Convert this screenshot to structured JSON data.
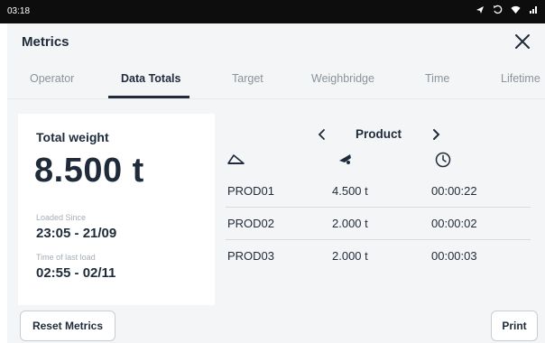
{
  "status_bar": {
    "time": "03:18",
    "icons": [
      "location-icon",
      "sync-icon",
      "wifi-icon",
      "signal-icon"
    ]
  },
  "header": {
    "title": "Metrics",
    "close_icon": "close-icon"
  },
  "tabs": [
    {
      "label": "Operator",
      "active": false
    },
    {
      "label": "Data Totals",
      "active": true
    },
    {
      "label": "Target",
      "active": false
    },
    {
      "label": "Weighbridge",
      "active": false
    },
    {
      "label": "Time",
      "active": false
    },
    {
      "label": "Lifetime",
      "active": false
    }
  ],
  "summary": {
    "title": "Total weight",
    "total": "8.500 t",
    "loaded_since_label": "Loaded Since",
    "loaded_since": "23:05 - 21/09",
    "last_load_label": "Time of last load",
    "last_load": "02:55 - 02/11"
  },
  "product_nav": {
    "prev": "<",
    "label": "Product",
    "next": ">"
  },
  "columns": [
    "load-icon",
    "weight-icon",
    "clock-icon"
  ],
  "rows": [
    {
      "product": "PROD01",
      "weight": "4.500 t",
      "time": "00:00:22"
    },
    {
      "product": "PROD02",
      "weight": "2.000 t",
      "time": "00:00:02"
    },
    {
      "product": "PROD03",
      "weight": "2.000 t",
      "time": "00:00:03"
    }
  ],
  "footer": {
    "reset_label": "Reset Metrics",
    "print_label": "Print"
  },
  "colors": {
    "primary_text": "#1f2b3a",
    "muted_text": "#8a939c",
    "background": "#f4f5f7",
    "card": "#ffffff"
  }
}
